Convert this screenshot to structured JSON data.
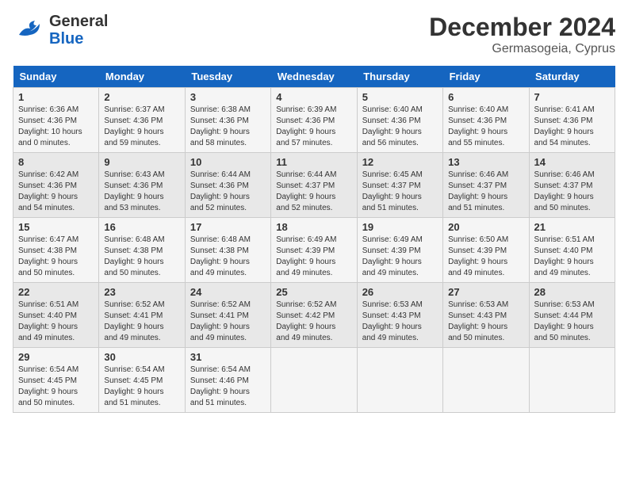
{
  "header": {
    "logo_general": "General",
    "logo_blue": "Blue",
    "title": "December 2024",
    "subtitle": "Germasogeia, Cyprus"
  },
  "calendar": {
    "days_of_week": [
      "Sunday",
      "Monday",
      "Tuesday",
      "Wednesday",
      "Thursday",
      "Friday",
      "Saturday"
    ],
    "weeks": [
      [
        {
          "day": "1",
          "sunrise": "Sunrise: 6:36 AM",
          "sunset": "Sunset: 4:36 PM",
          "daylight": "Daylight: 10 hours and 0 minutes."
        },
        {
          "day": "2",
          "sunrise": "Sunrise: 6:37 AM",
          "sunset": "Sunset: 4:36 PM",
          "daylight": "Daylight: 9 hours and 59 minutes."
        },
        {
          "day": "3",
          "sunrise": "Sunrise: 6:38 AM",
          "sunset": "Sunset: 4:36 PM",
          "daylight": "Daylight: 9 hours and 58 minutes."
        },
        {
          "day": "4",
          "sunrise": "Sunrise: 6:39 AM",
          "sunset": "Sunset: 4:36 PM",
          "daylight": "Daylight: 9 hours and 57 minutes."
        },
        {
          "day": "5",
          "sunrise": "Sunrise: 6:40 AM",
          "sunset": "Sunset: 4:36 PM",
          "daylight": "Daylight: 9 hours and 56 minutes."
        },
        {
          "day": "6",
          "sunrise": "Sunrise: 6:40 AM",
          "sunset": "Sunset: 4:36 PM",
          "daylight": "Daylight: 9 hours and 55 minutes."
        },
        {
          "day": "7",
          "sunrise": "Sunrise: 6:41 AM",
          "sunset": "Sunset: 4:36 PM",
          "daylight": "Daylight: 9 hours and 54 minutes."
        }
      ],
      [
        {
          "day": "8",
          "sunrise": "Sunrise: 6:42 AM",
          "sunset": "Sunset: 4:36 PM",
          "daylight": "Daylight: 9 hours and 54 minutes."
        },
        {
          "day": "9",
          "sunrise": "Sunrise: 6:43 AM",
          "sunset": "Sunset: 4:36 PM",
          "daylight": "Daylight: 9 hours and 53 minutes."
        },
        {
          "day": "10",
          "sunrise": "Sunrise: 6:44 AM",
          "sunset": "Sunset: 4:36 PM",
          "daylight": "Daylight: 9 hours and 52 minutes."
        },
        {
          "day": "11",
          "sunrise": "Sunrise: 6:44 AM",
          "sunset": "Sunset: 4:37 PM",
          "daylight": "Daylight: 9 hours and 52 minutes."
        },
        {
          "day": "12",
          "sunrise": "Sunrise: 6:45 AM",
          "sunset": "Sunset: 4:37 PM",
          "daylight": "Daylight: 9 hours and 51 minutes."
        },
        {
          "day": "13",
          "sunrise": "Sunrise: 6:46 AM",
          "sunset": "Sunset: 4:37 PM",
          "daylight": "Daylight: 9 hours and 51 minutes."
        },
        {
          "day": "14",
          "sunrise": "Sunrise: 6:46 AM",
          "sunset": "Sunset: 4:37 PM",
          "daylight": "Daylight: 9 hours and 50 minutes."
        }
      ],
      [
        {
          "day": "15",
          "sunrise": "Sunrise: 6:47 AM",
          "sunset": "Sunset: 4:38 PM",
          "daylight": "Daylight: 9 hours and 50 minutes."
        },
        {
          "day": "16",
          "sunrise": "Sunrise: 6:48 AM",
          "sunset": "Sunset: 4:38 PM",
          "daylight": "Daylight: 9 hours and 50 minutes."
        },
        {
          "day": "17",
          "sunrise": "Sunrise: 6:48 AM",
          "sunset": "Sunset: 4:38 PM",
          "daylight": "Daylight: 9 hours and 49 minutes."
        },
        {
          "day": "18",
          "sunrise": "Sunrise: 6:49 AM",
          "sunset": "Sunset: 4:39 PM",
          "daylight": "Daylight: 9 hours and 49 minutes."
        },
        {
          "day": "19",
          "sunrise": "Sunrise: 6:49 AM",
          "sunset": "Sunset: 4:39 PM",
          "daylight": "Daylight: 9 hours and 49 minutes."
        },
        {
          "day": "20",
          "sunrise": "Sunrise: 6:50 AM",
          "sunset": "Sunset: 4:39 PM",
          "daylight": "Daylight: 9 hours and 49 minutes."
        },
        {
          "day": "21",
          "sunrise": "Sunrise: 6:51 AM",
          "sunset": "Sunset: 4:40 PM",
          "daylight": "Daylight: 9 hours and 49 minutes."
        }
      ],
      [
        {
          "day": "22",
          "sunrise": "Sunrise: 6:51 AM",
          "sunset": "Sunset: 4:40 PM",
          "daylight": "Daylight: 9 hours and 49 minutes."
        },
        {
          "day": "23",
          "sunrise": "Sunrise: 6:52 AM",
          "sunset": "Sunset: 4:41 PM",
          "daylight": "Daylight: 9 hours and 49 minutes."
        },
        {
          "day": "24",
          "sunrise": "Sunrise: 6:52 AM",
          "sunset": "Sunset: 4:41 PM",
          "daylight": "Daylight: 9 hours and 49 minutes."
        },
        {
          "day": "25",
          "sunrise": "Sunrise: 6:52 AM",
          "sunset": "Sunset: 4:42 PM",
          "daylight": "Daylight: 9 hours and 49 minutes."
        },
        {
          "day": "26",
          "sunrise": "Sunrise: 6:53 AM",
          "sunset": "Sunset: 4:43 PM",
          "daylight": "Daylight: 9 hours and 49 minutes."
        },
        {
          "day": "27",
          "sunrise": "Sunrise: 6:53 AM",
          "sunset": "Sunset: 4:43 PM",
          "daylight": "Daylight: 9 hours and 50 minutes."
        },
        {
          "day": "28",
          "sunrise": "Sunrise: 6:53 AM",
          "sunset": "Sunset: 4:44 PM",
          "daylight": "Daylight: 9 hours and 50 minutes."
        }
      ],
      [
        {
          "day": "29",
          "sunrise": "Sunrise: 6:54 AM",
          "sunset": "Sunset: 4:45 PM",
          "daylight": "Daylight: 9 hours and 50 minutes."
        },
        {
          "day": "30",
          "sunrise": "Sunrise: 6:54 AM",
          "sunset": "Sunset: 4:45 PM",
          "daylight": "Daylight: 9 hours and 51 minutes."
        },
        {
          "day": "31",
          "sunrise": "Sunrise: 6:54 AM",
          "sunset": "Sunset: 4:46 PM",
          "daylight": "Daylight: 9 hours and 51 minutes."
        },
        null,
        null,
        null,
        null
      ]
    ]
  }
}
